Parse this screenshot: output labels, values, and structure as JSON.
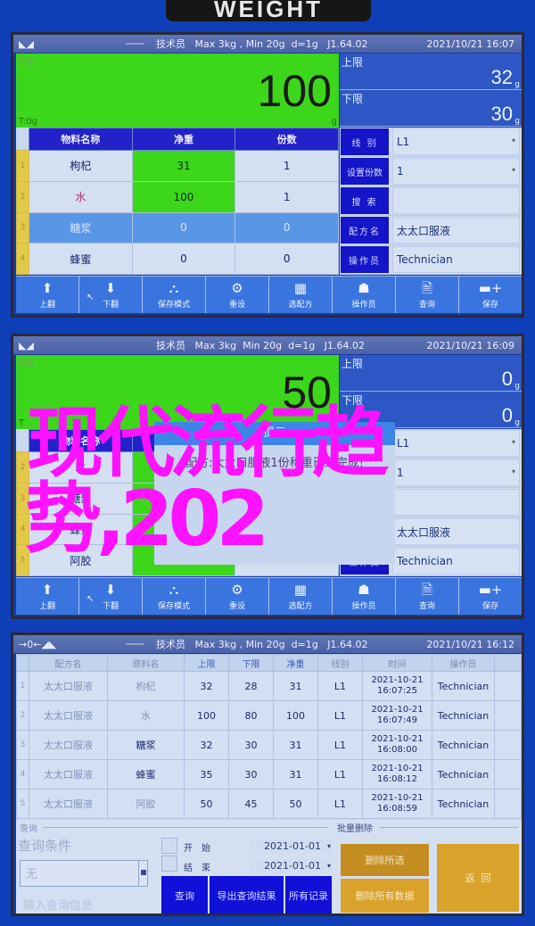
{
  "device": {
    "brand_label": "WEIGHT"
  },
  "screens": [
    {
      "status": {
        "role": "技术员",
        "spec": "Max 3kg , Min 20g  d=1g",
        "version": "J1.64.02",
        "datetime": "2021/10/21  16:07",
        "icon": "stable-icon"
      },
      "weight": {
        "label": "净重",
        "value": "100",
        "tare": "T:0g",
        "unit": "g"
      },
      "limits": {
        "upper_label": "上限",
        "upper_value": "32",
        "lower_label": "下限",
        "lower_value": "30",
        "unit": "g"
      },
      "table": {
        "headers": [
          "物料名称",
          "净重",
          "份数"
        ],
        "rows": [
          {
            "index": "1",
            "name": "枸杞",
            "net": "31",
            "count": "1"
          },
          {
            "index": "2",
            "name": "水",
            "net": "100",
            "count": "1"
          },
          {
            "index": "3",
            "name": "糖浆",
            "net": "0",
            "count": "0"
          },
          {
            "index": "4",
            "name": "蜂蜜",
            "net": "0",
            "count": "0"
          }
        ]
      },
      "side": {
        "line_label": "线 别",
        "line_value": "L1",
        "count_label": "设置份数",
        "count_value": "1",
        "search_label": "搜 索",
        "search_value": "",
        "recipe_label": "配方名",
        "recipe_value": "太太口服液",
        "operator_label": "操作员",
        "operator_value": "Technician"
      }
    },
    {
      "status": {
        "role": "技术员",
        "spec": "Max 3kg  Min 20g  d=1g",
        "version": "J1.64.02",
        "datetime": "2021/10/21  16:09",
        "icon": "stable-icon"
      },
      "weight": {
        "label": "净重",
        "value": "50",
        "tare": "T",
        "unit": "g"
      },
      "limits": {
        "upper_label": "上限",
        "upper_value": "0",
        "lower_label": "下限",
        "lower_value": "0",
        "unit": "g"
      },
      "table": {
        "headers": [
          "物料名称",
          "",
          ""
        ],
        "rows": [
          {
            "index": "1",
            "name": "",
            "net": "",
            "count": ""
          },
          {
            "index": "2",
            "name": "水",
            "net": "",
            "count": ""
          },
          {
            "index": "3",
            "name": "糖浆",
            "net": "",
            "count": ""
          },
          {
            "index": "4",
            "name": "蜂蜜",
            "net": "",
            "count": ""
          },
          {
            "index": "5",
            "name": "阿胶",
            "net": "",
            "count": ""
          }
        ]
      },
      "side": {
        "line_value": "L1",
        "count_value": "1",
        "recipe_value": "太太口服液",
        "operator_label": "操作员",
        "operator_value": "Technician"
      },
      "dialog": {
        "title": "提示",
        "message": "配方:太太口服液1份称重已经完成!"
      }
    }
  ],
  "toolbar": [
    {
      "label": "上翻",
      "icon": "arrow-up-icon",
      "glyph": "⬆"
    },
    {
      "label": "下翻",
      "icon": "arrow-down-icon",
      "glyph": "⬇"
    },
    {
      "label": "保存模式",
      "icon": "stack-icon",
      "glyph": "⛬"
    },
    {
      "label": "重设",
      "icon": "gear-icon",
      "glyph": "⚙"
    },
    {
      "label": "选配方",
      "icon": "calendar-icon",
      "glyph": "▦"
    },
    {
      "label": "操作员",
      "icon": "user-icon",
      "glyph": "☗"
    },
    {
      "label": "查询",
      "icon": "search-doc-icon",
      "glyph": "🗎"
    },
    {
      "label": "保存",
      "icon": "printer-plus-icon",
      "glyph": "▬+"
    }
  ],
  "overlay": {
    "line1": "现代流行趋",
    "line2": "势,202"
  },
  "query_screen": {
    "status": {
      "icon": "zero-stable-icon",
      "icon_text": "→0←◢◣",
      "role": "技术员",
      "spec": "Max 3kg , Min 20g  d=1g",
      "version": "J1.64.02",
      "datetime": "2021/10/21  16:12"
    },
    "headers": [
      "配方名",
      "原料名",
      "上限",
      "下限",
      "净重",
      "线别",
      "时间",
      "操作员"
    ],
    "rows": [
      {
        "index": "1",
        "recipe": "太太口服液",
        "material": "枸杞",
        "upper": "32",
        "lower": "28",
        "net": "31",
        "line": "L1",
        "date": "2021-10-21",
        "time": "16:07:25",
        "operator": "Technician"
      },
      {
        "index": "2",
        "recipe": "太太口服液",
        "material": "水",
        "upper": "100",
        "lower": "80",
        "net": "100",
        "line": "L1",
        "date": "2021-10-21",
        "time": "16:07:49",
        "operator": "Technician"
      },
      {
        "index": "3",
        "recipe": "太太口服液",
        "material": "糖浆",
        "upper": "32",
        "lower": "30",
        "net": "31",
        "line": "L1",
        "date": "2021-10-21",
        "time": "16:08:00",
        "operator": "Technician"
      },
      {
        "index": "4",
        "recipe": "太太口服液",
        "material": "蜂蜜",
        "upper": "35",
        "lower": "30",
        "net": "31",
        "line": "L1",
        "date": "2021-10-21",
        "time": "16:08:12",
        "operator": "Technician"
      },
      {
        "index": "5",
        "recipe": "太太口服液",
        "material": "阿胶",
        "upper": "50",
        "lower": "45",
        "net": "50",
        "line": "L1",
        "date": "2021-10-21",
        "time": "16:08:59",
        "operator": "Technician"
      }
    ],
    "query": {
      "group_title": "查询",
      "condition_label": "查询条件",
      "condition_value": "无",
      "input_placeholder": "输入查询信息",
      "start_label": "开始",
      "start_value": "2021-01-01",
      "end_label": "结束",
      "end_value": "2021-01-01",
      "query_button": "查询",
      "export_button": "导出查询结果",
      "all_button": "所有记录"
    },
    "batch_delete": {
      "group_title": "批量删除",
      "delete_selected": "删除所选",
      "delete_all": "删除所有数据",
      "back": "返  回"
    }
  }
}
